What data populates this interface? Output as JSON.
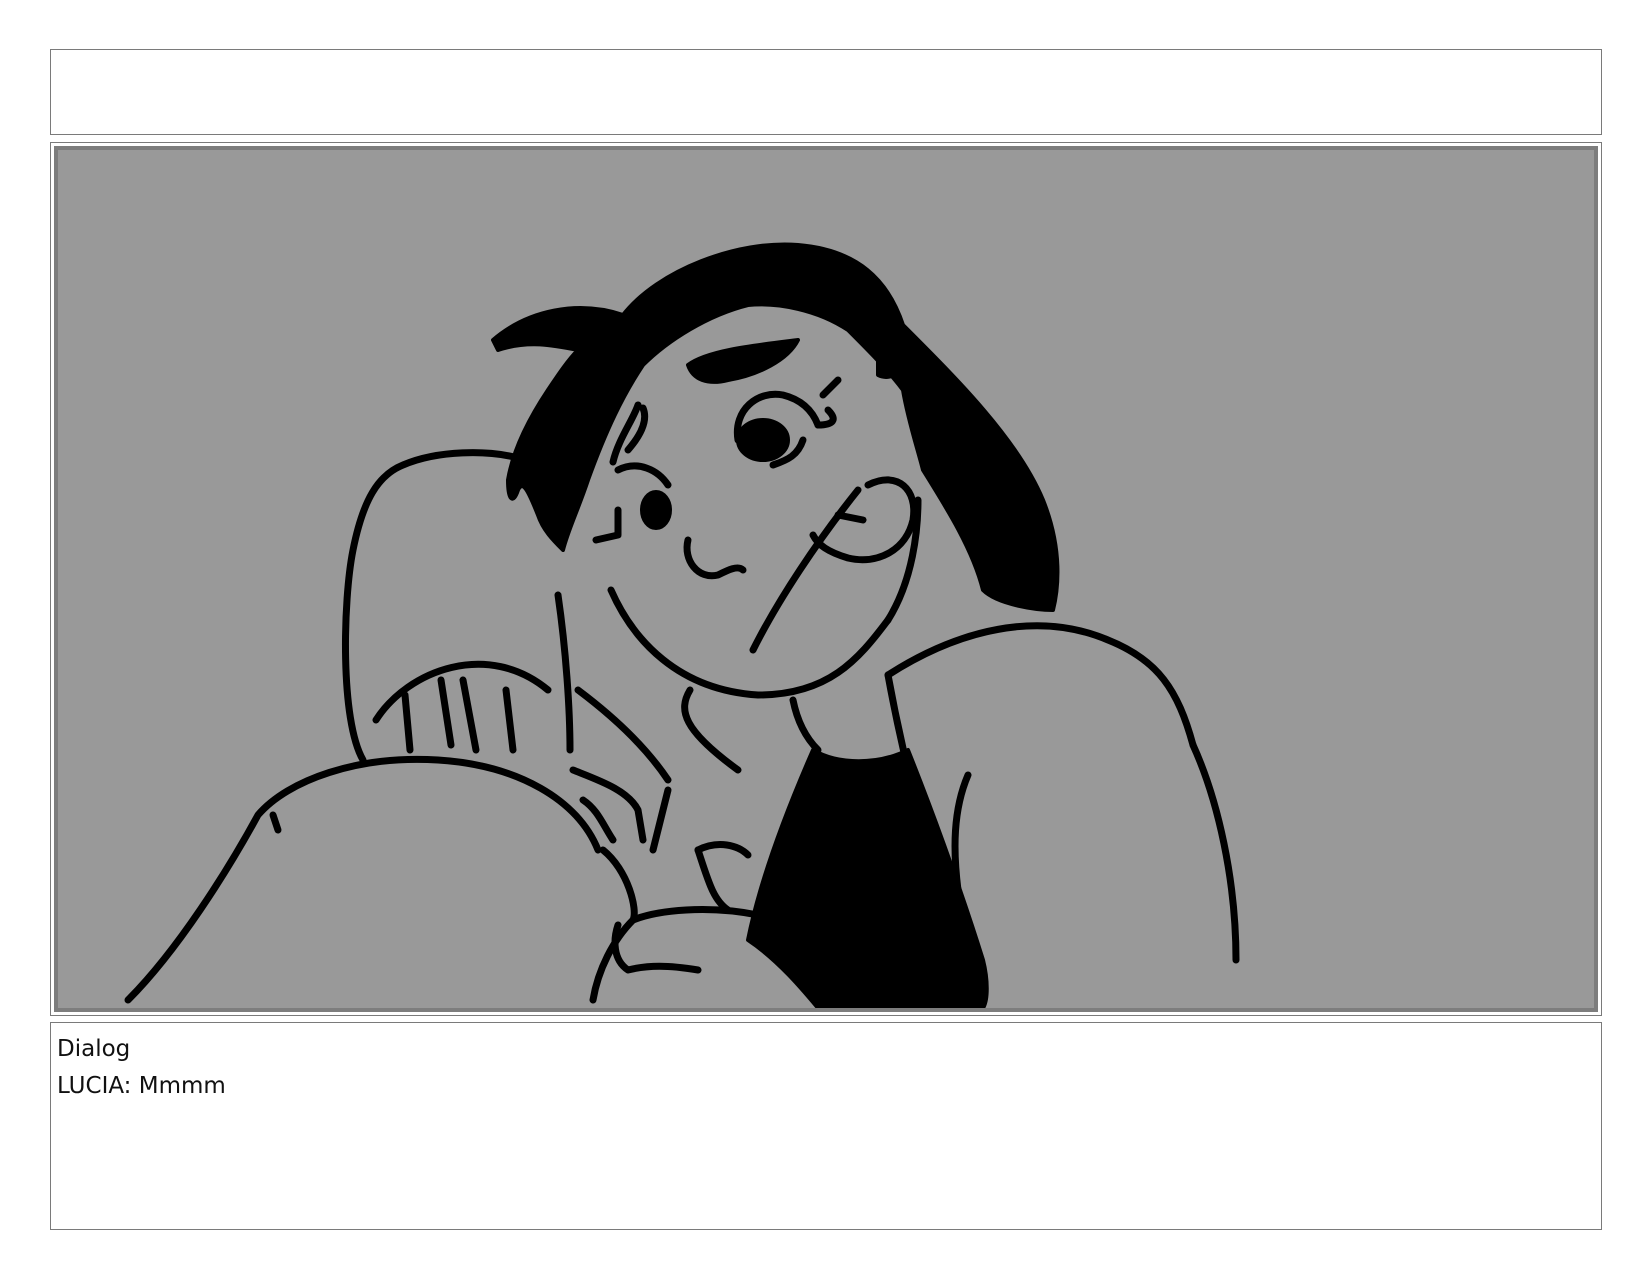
{
  "header": {
    "text": ""
  },
  "panel": {
    "background_color": "#999999",
    "frame_color": "#7d7d7d",
    "ink_color": "#000000",
    "art": "storyboard-sketch-icon"
  },
  "dialog": {
    "label": "Dialog",
    "line": "LUCIA: Mmmm"
  }
}
